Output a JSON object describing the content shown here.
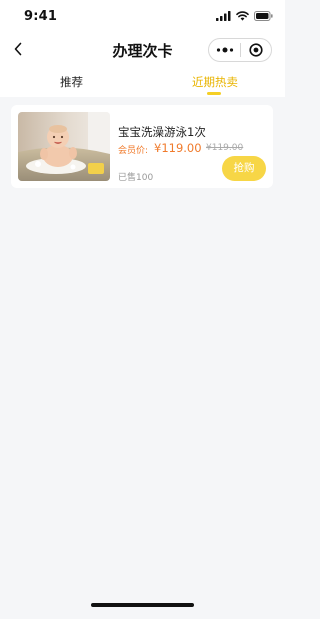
{
  "status_bar": {
    "time": "9:41"
  },
  "nav": {
    "title": "办理次卡",
    "back_icon": "chevron-left-icon",
    "capsule_icons": [
      "more-dots-icon",
      "close-target-icon"
    ]
  },
  "tabs": [
    {
      "label": "推荐",
      "active": false
    },
    {
      "label": "近期热卖",
      "active": true
    }
  ],
  "products": [
    {
      "title": "宝宝洗澡游泳1次",
      "price_label": "会员价:",
      "price": "¥119.00",
      "original_price": "¥119.00",
      "sold": "已售100",
      "buy_label": "抢购",
      "image_icon": "baby-bath-photo"
    }
  ],
  "colors": {
    "accent": "#f5cf25",
    "button": "#f7d646",
    "tab_active": "#e9b400",
    "price": "#f07a2b",
    "background": "#f5f6f8"
  }
}
